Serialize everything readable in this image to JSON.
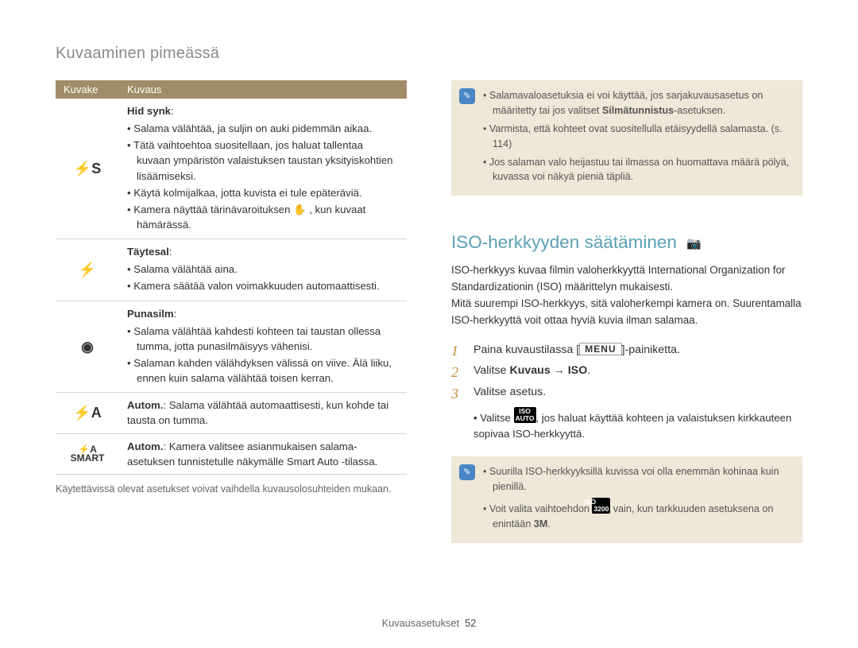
{
  "page_title": "Kuvaaminen pimeässä",
  "table": {
    "head_icon": "Kuvake",
    "head_desc": "Kuvaus",
    "rows": [
      {
        "icon": "⚡S",
        "label": "Hid synk",
        "bullets": [
          "Salama välähtää, ja suljin on auki pidemmän aikaa.",
          "Tätä vaihtoehtoa suositellaan, jos haluat tallentaa kuvaan ympäristön valaistuksen taustan yksityiskohtien lisäämiseksi.",
          "Käytä kolmijalkaa, jotta kuvista ei tule epäteräviä.",
          "Kamera näyttää tärinävaroituksen  ✋ , kun kuvaat hämärässä."
        ]
      },
      {
        "icon": "⚡",
        "label": "Täytesal",
        "bullets": [
          "Salama välähtää aina.",
          "Kamera säätää valon voimakkuuden automaattisesti."
        ]
      },
      {
        "icon": "◉",
        "label": "Punasilm",
        "bullets": [
          "Salama välähtää kahdesti kohteen tai taustan ollessa tumma, jotta punasilmäisyys vähenisi.",
          "Salaman kahden välähdyksen välissä on viive. Älä liiku, ennen kuin salama välähtää toisen kerran."
        ]
      },
      {
        "icon": "⚡A",
        "plain": "Autom.: Salama välähtää automaattisesti, kun kohde tai tausta on tumma.",
        "plain_bold": "Autom."
      },
      {
        "icon": "⚡A\nSMART",
        "plain": "Autom.: Kamera valitsee asianmukaisen salama-asetuksen tunnistetulle näkymälle Smart Auto -tilassa.",
        "plain_bold": "Autom."
      }
    ]
  },
  "footnote_left": "Käytettävissä olevat asetukset voivat vaihdella kuvausolosuhteiden mukaan.",
  "note1": {
    "items": [
      {
        "pre": "Salamavaloasetuksia ei voi käyttää, jos sarjakuvausasetus on määritetty tai jos valitset ",
        "bold": "Silmätunnistus",
        "post": "-asetuksen."
      },
      {
        "plain": "Varmista, että kohteet ovat suositellulla etäisyydellä salamasta. (s. 114)"
      },
      {
        "plain": "Jos salaman valo heijastuu tai ilmassa on huomattava määrä pölyä, kuvassa voi näkyä pieniä täpliä."
      }
    ]
  },
  "section_heading": "ISO-herkkyyden säätäminen",
  "section_prose": "ISO-herkkyys kuvaa filmin valoherkkyyttä International Organization for Standardizationin (ISO) määrittelyn mukaisesti.\nMitä suurempi ISO-herkkyys, sitä valoherkempi kamera on. Suurentamalla ISO-herkkyyttä voit ottaa hyviä kuvia ilman salamaa.",
  "steps": [
    {
      "n": "1",
      "pre": "Paina kuvaustilassa [",
      "btn": "MENU",
      "post": "]-painiketta."
    },
    {
      "n": "2",
      "text_pre": "Valitse ",
      "bold": "Kuvaus → ISO",
      "text_post": "."
    },
    {
      "n": "3",
      "plain": "Valitse asetus."
    }
  ],
  "substep": {
    "pre": "Valitse ",
    "glyph": "ISO AUTO",
    "post": ", jos haluat käyttää kohteen ja valaistuksen kirkkauteen sopivaa ISO-herkkyyttä."
  },
  "note2": {
    "items": [
      {
        "plain": "Suurilla ISO-herkkyyksillä kuvissa voi olla enemmän kohinaa kuin pienillä."
      },
      {
        "pre": "Voit valita vaihtoehdon ",
        "glyph": "ISO 3200",
        "mid": " vain, kun tarkkuuden asetuksena on enintään ",
        "bold": "3M",
        "post": "."
      }
    ]
  },
  "footer": {
    "label": "Kuvausasetukset",
    "page": "52"
  }
}
